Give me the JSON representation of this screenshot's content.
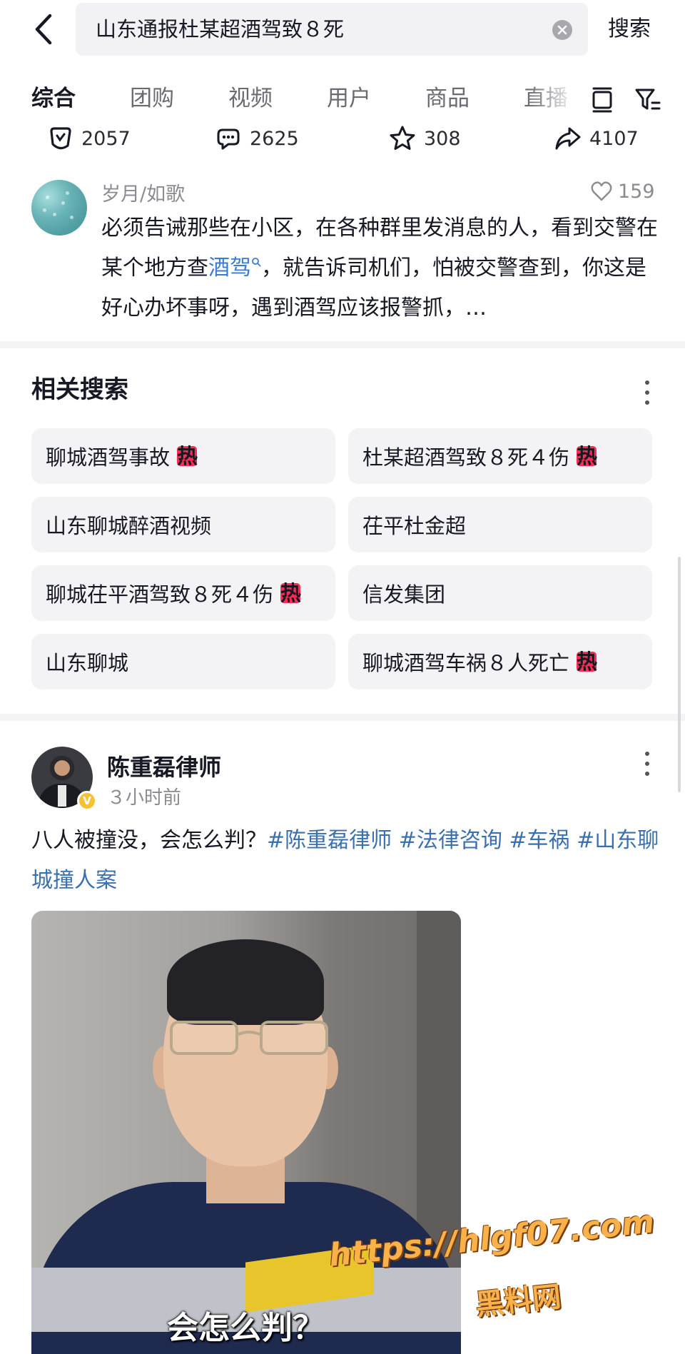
{
  "search": {
    "query": "山东通报杜某超酒驾致８死",
    "submit_label": "搜索"
  },
  "tabs": [
    {
      "label": "综合",
      "active": true
    },
    {
      "label": "团购"
    },
    {
      "label": "视频"
    },
    {
      "label": "用户"
    },
    {
      "label": "商品"
    },
    {
      "label": "直播"
    }
  ],
  "stats": {
    "comments": "2057",
    "chats": "2625",
    "favorites": "308",
    "shares": "4107"
  },
  "comment": {
    "author": "岁月/如歌",
    "likes": "159",
    "text_part1": "必须告诫那些在小区，在各种群里发消息的人，看到交警在某个地方查",
    "keyword": "酒驾",
    "text_part2": "，就告诉司机们，怕被交警查到，你这是好心办坏事呀，遇到酒驾应该报警抓，…"
  },
  "related": {
    "title": "相关搜索",
    "hot_label": "热",
    "items": [
      {
        "text": "聊城酒驾事故",
        "hot": true
      },
      {
        "text": "杜某超酒驾致８死４伤",
        "hot": true
      },
      {
        "text": "山东聊城醉酒视频",
        "hot": false
      },
      {
        "text": "茌平杜金超",
        "hot": false
      },
      {
        "text": "聊城茌平酒驾致８死４伤",
        "hot": true
      },
      {
        "text": "信发集团",
        "hot": false
      },
      {
        "text": "山东聊城",
        "hot": false
      },
      {
        "text": "聊城酒驾车祸８人死亡",
        "hot": true
      }
    ]
  },
  "post": {
    "author": "陈重磊律师",
    "time": "３小时前",
    "verified_mark": "V",
    "text": "八人被撞没，会怎么判？",
    "tags": [
      "#陈重磊律师",
      "#法律咨询",
      "#车祸",
      "#山东聊城撞人案"
    ],
    "video_caption": "会怎么判？"
  },
  "watermark": {
    "line1": "https://hlgf07.com",
    "line2": "黑料网"
  }
}
